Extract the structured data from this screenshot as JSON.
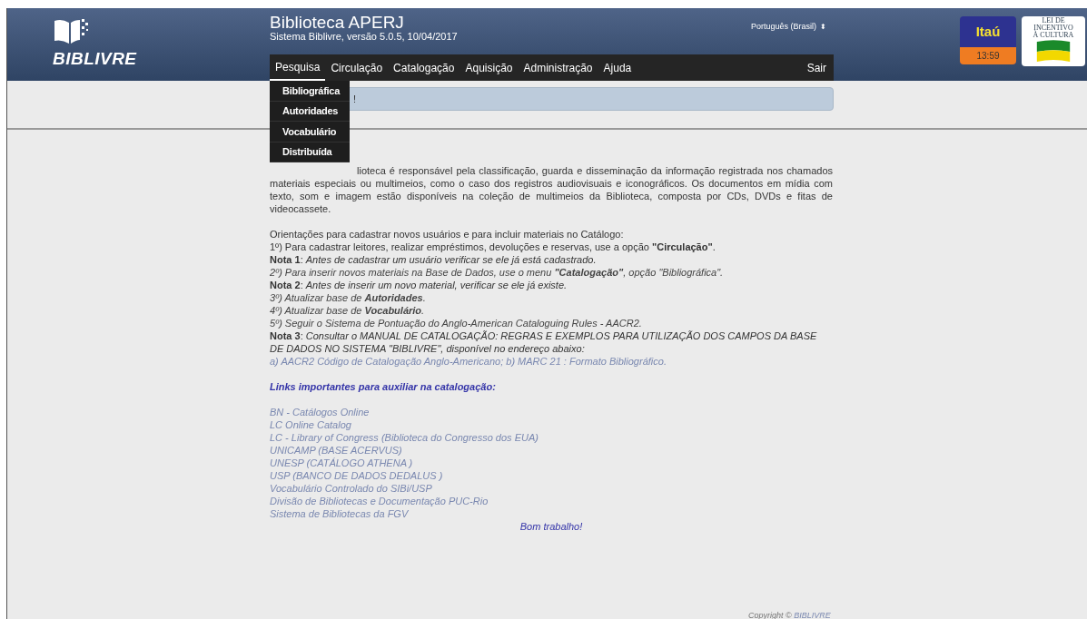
{
  "logo": {
    "text": "BIBLIVRE"
  },
  "header": {
    "title": "Biblioteca APERJ",
    "subtitle": "Sistema Biblivre, versão 5.0.5, 10/04/2017",
    "language": "Português (Brasil)",
    "language_arrows": "⬍"
  },
  "sponsors": {
    "itau": {
      "name": "Itaú",
      "time": "13:59"
    },
    "incentivo": {
      "lines": [
        "LEI DE",
        "INCENTIVO",
        "À CULTURA"
      ]
    }
  },
  "menu": {
    "items": [
      {
        "label": "Pesquisa",
        "selected": true
      },
      {
        "label": "Circulação",
        "selected": false
      },
      {
        "label": "Catalogação",
        "selected": false
      },
      {
        "label": "Aquisição",
        "selected": false
      },
      {
        "label": "Administração",
        "selected": false
      },
      {
        "label": "Ajuda",
        "selected": false
      }
    ],
    "logout": "Sair"
  },
  "dropdown": {
    "items": [
      {
        "label": "Bibliográfica"
      },
      {
        "label": "Autoridades"
      },
      {
        "label": "Vocabulário"
      },
      {
        "label": "Distribuída"
      }
    ]
  },
  "alert": {
    "text": "!"
  },
  "intro": "lioteca é responsável pela classificação, guarda e disseminação da informação registrada nos chamados materiais especiais ou multimeios, como o caso dos registros audiovisuais e iconográficos. Os documentos em mídia com texto, som e imagem estão disponíveis na coleção de multimeios da Biblioteca, composta por CDs, DVDs e fitas de videocassete.",
  "instructions": [
    {
      "kind": "plain",
      "text": "Orientações para cadastrar novos usuários e para incluir materiais no Catálogo:"
    },
    {
      "kind": "plain",
      "text": "1º) Para cadastrar leitores, realizar empréstimos, devoluções e reservas, use a opção **\"Circulação\"**."
    },
    {
      "kind": "plain",
      "text": "**Nota 1**: *Antes de cadastrar um usuário verificar se ele já está cadastrado.*"
    },
    {
      "kind": "italic",
      "text": "2º) Para inserir novos materiais na Base de Dados, use o menu **\"Catalogação\"**, opção \"Bibliográfica\"."
    },
    {
      "kind": "plain",
      "text": "**Nota 2**: *Antes de inserir um novo material, verificar se ele já existe.*"
    },
    {
      "kind": "italic",
      "text": "3º) Atualizar base de **Autoridades**."
    },
    {
      "kind": "italic",
      "text": "4º) Atualizar base de **Vocabulário**."
    },
    {
      "kind": "italic",
      "text": "5º) Seguir o Sistema de Pontuação do Anglo-American Cataloguing Rules - AACR2."
    },
    {
      "kind": "plain",
      "text": "**Nota 3**: *Consultar o MANUAL DE CATALOGAÇÃO: REGRAS E EXEMPLOS PARA UTILIZAÇÃO DOS CAMPOS DA BASE DE DADOS NO SISTEMA \"BIBLIVRE\", disponível no endereço abaixo:*"
    },
    {
      "kind": "link",
      "text": "a) AACR2 Código de Catalogação Anglo-Americano; b) MARC 21 : Formato Bibliográfico."
    }
  ],
  "links_heading": "Links importantes para auxiliar na catalogação:",
  "links": [
    "BN - Catálogos Online",
    "LC Online Catalog",
    "LC - Library of Congress (Biblioteca do Congresso dos EUA)",
    "UNICAMP (BASE ACERVUS)",
    "UNESP (CATÁLOGO ATHENA )",
    "USP (BANCO DE DADOS DEDALUS )",
    "Vocabulário Controlado do SIBi/USP",
    "Divisão de Bibliotecas e Documentação PUC-Rio",
    "Sistema de Bibliotecas da FGV"
  ],
  "closing": "Bom trabalho!",
  "footer": {
    "copyright": "Copyright ©",
    "brand": "BIBLIVRE"
  }
}
